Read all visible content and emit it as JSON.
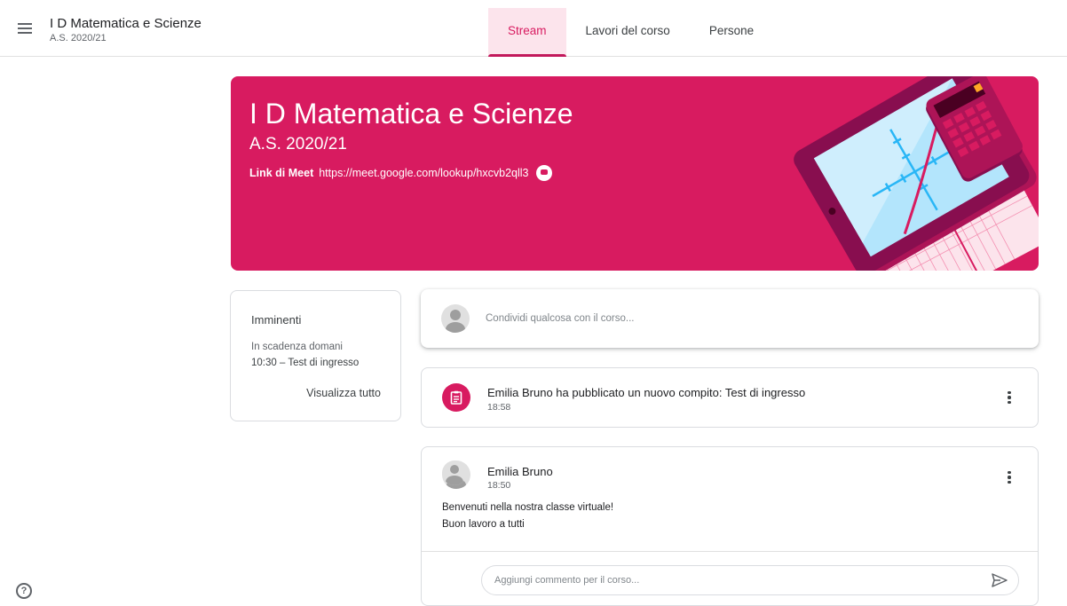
{
  "header": {
    "course_title": "I D Matematica e Scienze",
    "course_subtitle": "A.S. 2020/21",
    "tabs": [
      {
        "label": "Stream",
        "active": true
      },
      {
        "label": "Lavori del corso",
        "active": false
      },
      {
        "label": "Persone",
        "active": false
      }
    ]
  },
  "banner": {
    "title": "I D Matematica e Scienze",
    "year": "A.S. 2020/21",
    "meet_label": "Link di Meet",
    "meet_url": "https://meet.google.com/lookup/hxcvb2qll3",
    "color": "#d81b60"
  },
  "upcoming": {
    "title": "Imminenti",
    "due_label": "In scadenza domani",
    "due_item": "10:30 – Test di ingresso",
    "view_all": "Visualizza tutto"
  },
  "share_box": {
    "placeholder": "Condividi qualcosa con il corso..."
  },
  "posts": [
    {
      "type": "assignment",
      "text": "Emilia Bruno ha pubblicato un nuovo compito: Test di ingresso",
      "time": "18:58",
      "icon": "assignment-icon"
    },
    {
      "type": "announcement",
      "author": "Emilia Bruno",
      "time": "18:50",
      "message_line1": "Benvenuti nella nostra classe virtuale!",
      "message_line2": "Buon lavoro a tutti",
      "comment_placeholder": "Aggiungi commento per il corso..."
    }
  ],
  "icons": {
    "menu": "menu-icon",
    "meet": "meet-icon",
    "more": "more-vert-icon",
    "send": "send-icon",
    "help": "help-icon"
  },
  "help_glyph": "?"
}
